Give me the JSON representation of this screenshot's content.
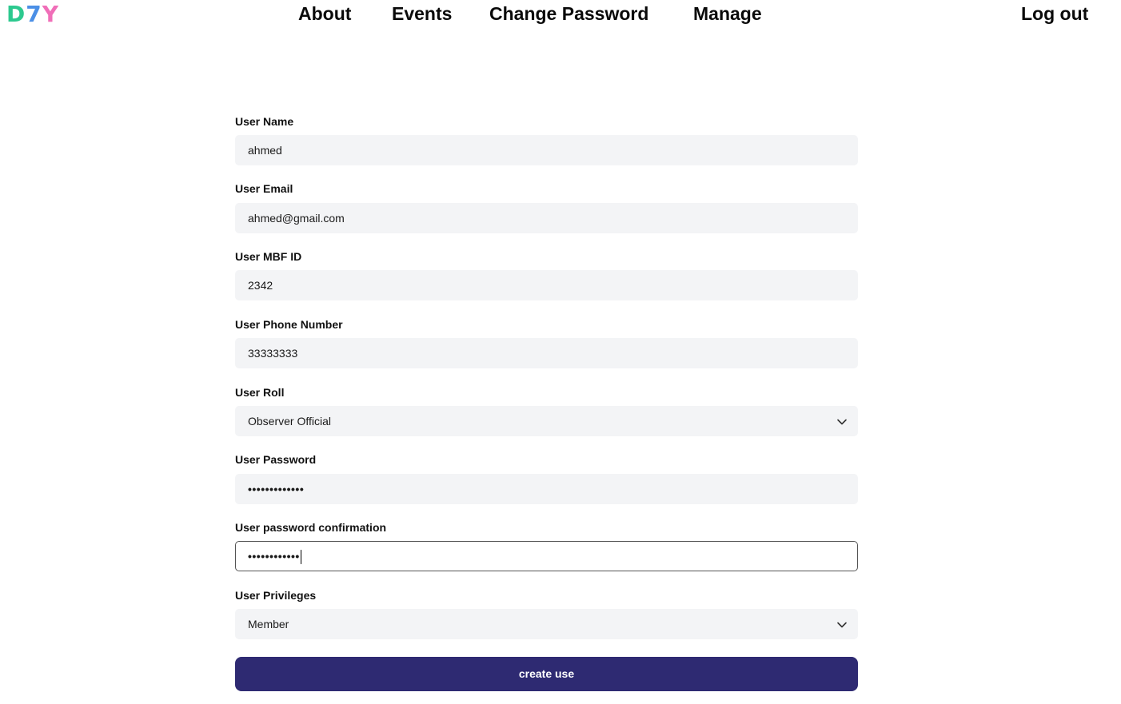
{
  "logo": {
    "part1": "D",
    "part2": "7",
    "part3": "Y"
  },
  "nav": {
    "about": "About",
    "events": "Events",
    "change_password": "Change Password",
    "manage": "Manage",
    "logout": "Log out"
  },
  "form": {
    "user_name": {
      "label": "User Name",
      "value": "ahmed"
    },
    "user_email": {
      "label": "User Email",
      "value": "ahmed@gmail.com"
    },
    "user_mbf_id": {
      "label": "User MBF ID",
      "value": "2342"
    },
    "user_phone": {
      "label": "User Phone Number",
      "value": "33333333"
    },
    "user_roll": {
      "label": "User Roll",
      "value": "Observer Official"
    },
    "user_password": {
      "label": "User Password",
      "value": "•••••••••••••"
    },
    "user_password_confirmation": {
      "label": "User password confirmation",
      "value": "••••••••••••"
    },
    "user_privileges": {
      "label": "User Privileges",
      "value": "Member"
    },
    "submit_label": "create use"
  },
  "colors": {
    "logo_d": "#2dc98f",
    "logo_7": "#4b8fe6",
    "logo_y": "#f06eb8",
    "button": "#2e2a72",
    "input_bg": "#f3f4f6"
  },
  "icons": {
    "select_arrow": "chevron-down-icon"
  }
}
